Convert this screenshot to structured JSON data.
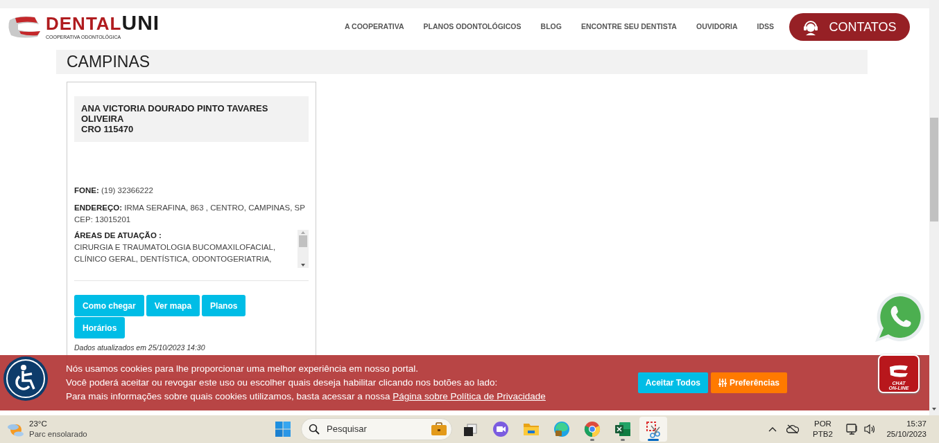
{
  "logo": {
    "first": "DENTAL",
    "second": "UNI",
    "tagline": "COOPERATIVA ODONTOLÓGICA"
  },
  "nav": [
    "A COOPERATIVA",
    "PLANOS ODONTOLÓGICOS",
    "BLOG",
    "ENCONTRE SEU DENTISTA",
    "OUVIDORIA",
    "IDSS"
  ],
  "contact_button": "CONTATOS",
  "city": "CAMPINAS",
  "dentist": {
    "name": "ANA VICTORIA DOURADO PINTO TAVARES OLIVEIRA",
    "cro": "CRO 115470",
    "phone_label": "FONE:",
    "phone": "(19) 32366222",
    "address_label": "ENDEREÇO:",
    "address": "IRMA SERAFINA, 863 , CENTRO, CAMPINAS, SP",
    "cep": "CEP: 13015201",
    "areas_label": "ÁREAS DE ATUAÇÃO :",
    "areas_lines": [
      "CIRURGIA E TRAUMATOLOGIA BUCOMAXILOFACIAL,",
      "CLÍNICO GERAL, DENTÍSTICA, ODONTOGERIATRIA,"
    ],
    "buttons": [
      "Como chegar",
      "Ver mapa",
      "Planos",
      "Horários"
    ],
    "updated": "Dados atualizados em 25/10/2023 14:30"
  },
  "cookie_banner": {
    "lines": [
      "Nós usamos cookies para lhe proporcionar uma melhor experiência em nosso portal.",
      "Você poderá aceitar ou revogar este uso ou escolher quais deseja habilitar clicando nos botões ao lado:"
    ],
    "last_line": "Para mais informações sobre quais cookies utilizamos, basta acessar a nossa",
    "link": "Página sobre Política de Privacidade",
    "accept": "Aceitar Todos",
    "preferences": "Preferências"
  },
  "chat_badge": {
    "line1": "CHAT",
    "line2": "ON-LINE"
  },
  "taskbar": {
    "temperature": "23°C",
    "weather": "Parc ensolarado",
    "search_placeholder": "Pesquisar",
    "apps": [
      {
        "kind": "taskview",
        "running": false,
        "selected": false
      },
      {
        "kind": "meet",
        "running": false,
        "selected": false
      },
      {
        "kind": "folder",
        "running": false,
        "selected": false
      },
      {
        "kind": "edge",
        "running": false,
        "selected": false
      },
      {
        "kind": "chrome",
        "running": true,
        "selected": false
      },
      {
        "kind": "excel",
        "running": true,
        "selected": false
      },
      {
        "kind": "snip",
        "running": true,
        "selected": true
      }
    ],
    "language": "POR",
    "layout": "PTB2",
    "time": "15:37",
    "date": "25/10/2023"
  }
}
